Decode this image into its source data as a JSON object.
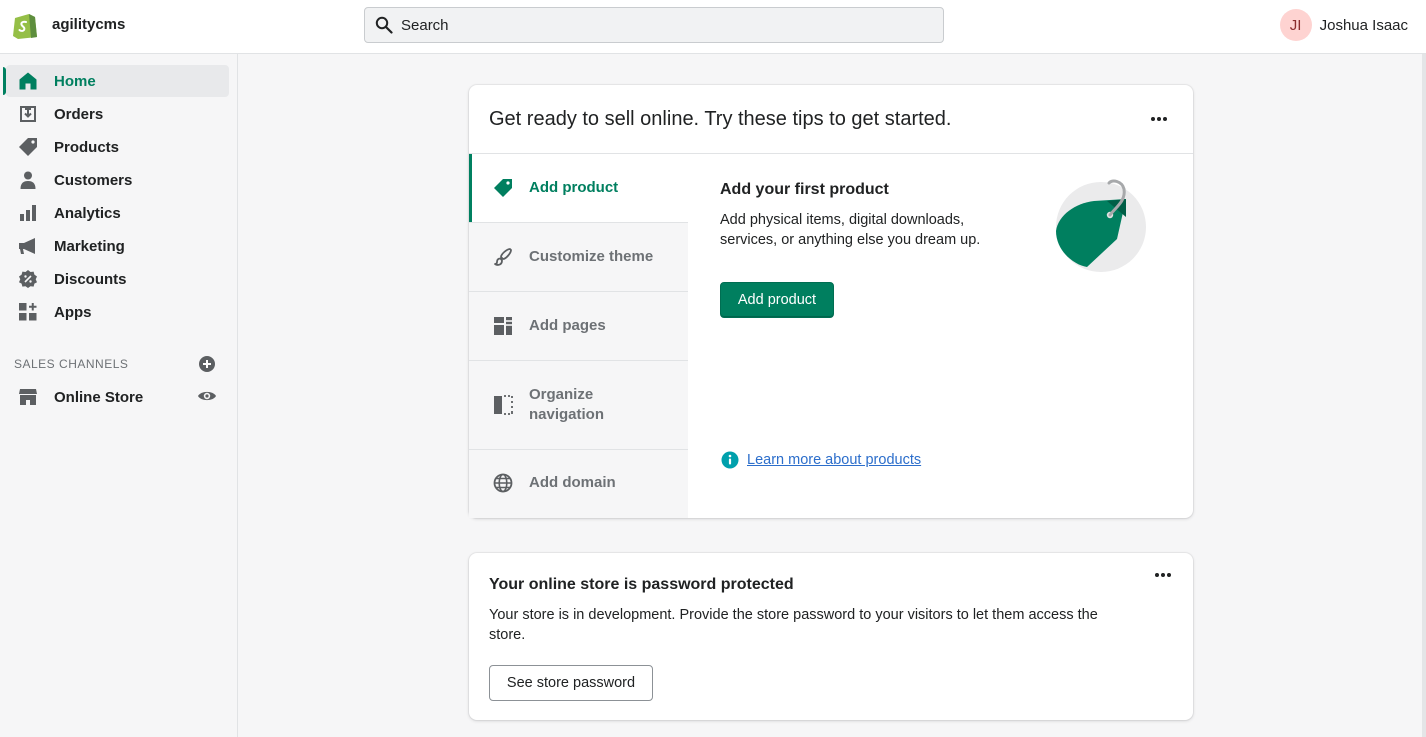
{
  "topbar": {
    "store_name": "agilitycms",
    "search_placeholder": "Search",
    "user_initials": "JI",
    "user_name": "Joshua Isaac"
  },
  "sidebar": {
    "items": [
      {
        "label": "Home",
        "icon": "home-icon",
        "active": true
      },
      {
        "label": "Orders",
        "icon": "orders-icon"
      },
      {
        "label": "Products",
        "icon": "tag-icon"
      },
      {
        "label": "Customers",
        "icon": "person-icon"
      },
      {
        "label": "Analytics",
        "icon": "bar-chart-icon"
      },
      {
        "label": "Marketing",
        "icon": "megaphone-icon"
      },
      {
        "label": "Discounts",
        "icon": "discount-icon"
      },
      {
        "label": "Apps",
        "icon": "apps-icon"
      }
    ],
    "sales_channels_title": "SALES CHANNELS",
    "channels": [
      {
        "label": "Online Store",
        "icon": "store-icon"
      }
    ]
  },
  "setup_card": {
    "title": "Get ready to sell online. Try these tips to get started.",
    "tabs": [
      {
        "label": "Add product",
        "icon": "tag-icon",
        "active": true
      },
      {
        "label": "Customize theme",
        "icon": "brush-icon"
      },
      {
        "label": "Add pages",
        "icon": "pages-icon"
      },
      {
        "label": "Organize navigation",
        "icon": "navigation-icon"
      },
      {
        "label": "Add domain",
        "icon": "globe-icon"
      }
    ],
    "panel": {
      "title": "Add your first product",
      "description": "Add physical items, digital downloads, services, or anything else you dream up.",
      "button": "Add product",
      "link": "Learn more about products"
    }
  },
  "password_card": {
    "title": "Your online store is password protected",
    "description": "Your store is in development. Provide the store password to your visitors to let them access the store.",
    "button": "See store password"
  },
  "colors": {
    "accent": "#007f5f",
    "link": "#2c6ecb",
    "avatar_bg": "#fed3d1"
  }
}
